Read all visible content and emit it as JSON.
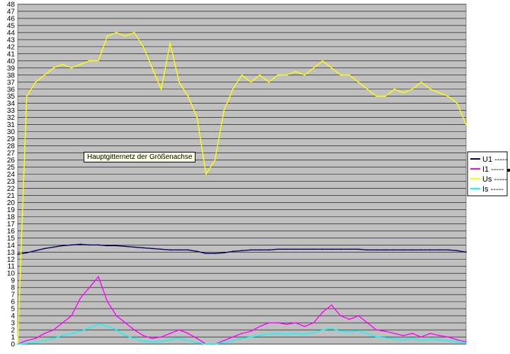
{
  "chart_data": {
    "type": "line",
    "title": "",
    "xlabel": "",
    "ylabel": "",
    "ylim": [
      0,
      48
    ],
    "y_ticks": [
      "0",
      "1",
      "2",
      "3",
      "4",
      "5",
      "6",
      "7",
      "8",
      "9",
      "10",
      "11",
      "12",
      "13",
      "14",
      "15",
      "16",
      "17",
      "18",
      "19",
      "20",
      "21",
      "22",
      "23",
      "24",
      "25",
      "26",
      "27",
      "28",
      "29",
      "30",
      "31",
      "32",
      "33",
      "34",
      "35",
      "36",
      "37",
      "38",
      "39",
      "40",
      "41",
      "42",
      "43",
      "44",
      "45",
      "46",
      "47",
      "48"
    ],
    "grid": true,
    "plot_background": "#c0c0c0",
    "legend_position": "right",
    "x": [
      0,
      2,
      4,
      6,
      8,
      10,
      12,
      14,
      16,
      18,
      20,
      22,
      24,
      26,
      28,
      30,
      32,
      34,
      36,
      38,
      40,
      42,
      44,
      46,
      48,
      50,
      52,
      54,
      56,
      58,
      60,
      62,
      64,
      66,
      68,
      70,
      72,
      74,
      76,
      78,
      80,
      82,
      84,
      86,
      88,
      90,
      92,
      94,
      96,
      98,
      100
    ],
    "series": [
      {
        "name": "U1 -----",
        "color": "#000066",
        "values": [
          12.7,
          12.9,
          13.2,
          13.5,
          13.7,
          13.9,
          14.0,
          14.1,
          14.0,
          14.0,
          13.9,
          13.9,
          13.8,
          13.7,
          13.6,
          13.5,
          13.4,
          13.3,
          13.3,
          13.3,
          13.1,
          12.8,
          12.8,
          12.9,
          13.1,
          13.2,
          13.3,
          13.3,
          13.3,
          13.4,
          13.4,
          13.4,
          13.4,
          13.4,
          13.4,
          13.4,
          13.4,
          13.4,
          13.4,
          13.3,
          13.3,
          13.3,
          13.3,
          13.3,
          13.3,
          13.3,
          13.3,
          13.3,
          13.3,
          13.2,
          13.0
        ]
      },
      {
        "name": "I1 -----",
        "color": "#ff00ff",
        "values": [
          0.0,
          0.5,
          0.8,
          1.5,
          2.0,
          3.0,
          4.0,
          6.5,
          8.0,
          9.5,
          6.0,
          4.0,
          3.0,
          2.0,
          1.2,
          0.8,
          1.0,
          1.5,
          2.0,
          1.5,
          0.8,
          0.0,
          0.0,
          0.5,
          1.0,
          1.5,
          1.8,
          2.5,
          3.0,
          3.0,
          2.8,
          3.0,
          2.5,
          3.0,
          4.5,
          5.5,
          4.0,
          3.5,
          4.0,
          3.0,
          2.0,
          1.8,
          1.5,
          1.2,
          1.5,
          1.0,
          1.5,
          1.2,
          1.0,
          0.6,
          0.3
        ]
      },
      {
        "name": "Us -----",
        "color": "#ffff00",
        "values": [
          0,
          35,
          37,
          38,
          39,
          39.5,
          39,
          39.5,
          40,
          40,
          43.5,
          44,
          43.5,
          44,
          42,
          39,
          36,
          42.5,
          37,
          35,
          32,
          24,
          26,
          33,
          36,
          38,
          37,
          38,
          37,
          38,
          38,
          38.5,
          38,
          39,
          40,
          39,
          38,
          38,
          37,
          36,
          35,
          35,
          36,
          35.5,
          36,
          37,
          36,
          35.5,
          35,
          34,
          31
        ]
      },
      {
        "name": "Is -----",
        "color": "#00ffff",
        "values": [
          0.0,
          0.1,
          0.2,
          0.5,
          0.8,
          1.2,
          1.5,
          1.8,
          2.3,
          2.8,
          2.5,
          2.0,
          1.2,
          0.8,
          0.4,
          0.3,
          0.4,
          0.6,
          0.8,
          0.5,
          0.2,
          0.0,
          0.0,
          0.2,
          0.5,
          0.8,
          1.0,
          1.2,
          1.4,
          1.5,
          1.4,
          1.5,
          1.4,
          1.6,
          2.0,
          2.2,
          1.8,
          1.7,
          1.9,
          1.5,
          1.0,
          0.9,
          0.7,
          0.6,
          0.8,
          0.5,
          0.7,
          0.6,
          0.5,
          0.3,
          0.2
        ]
      }
    ]
  },
  "tooltip": {
    "text": "Hauptgitternetz der Größenachse"
  }
}
